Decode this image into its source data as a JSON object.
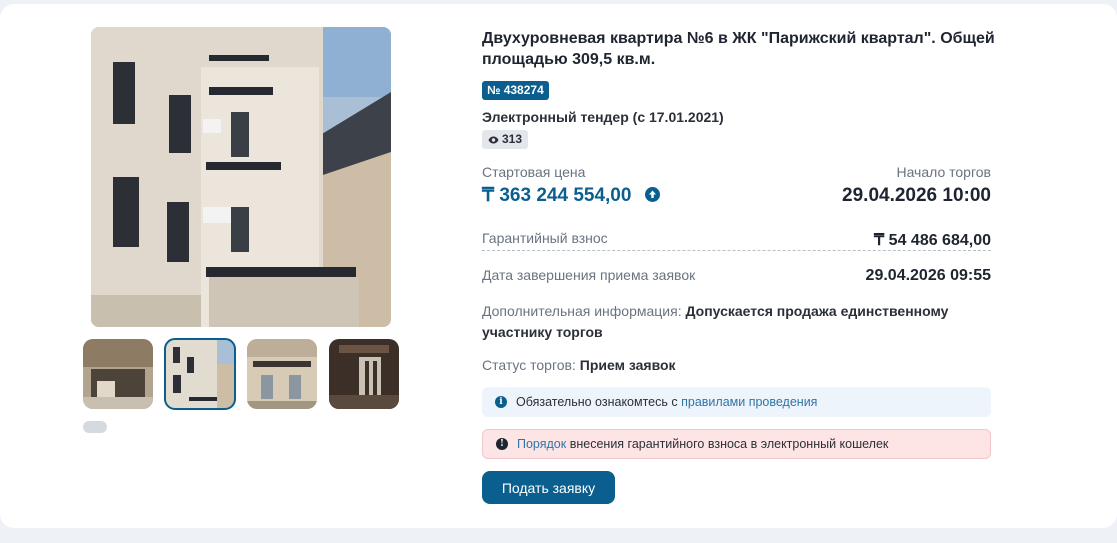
{
  "lot": {
    "title": "Двухуровневая квартира №6 в ЖК \"Парижский квартал\". Общей площадью 309,5 кв.м.",
    "number_badge": "№ 438274",
    "tender_type": "Электронный тендер (с 17.01.2021)",
    "views": "313"
  },
  "pricing": {
    "start_price_label": "Стартовая цена",
    "start_price_value": "₸ 363 244 554,00",
    "auction_start_label": "Начало торгов",
    "auction_start_value": "29.04.2026 10:00",
    "deposit_label": "Гарантийный взнос",
    "deposit_value": "₸ 54 486 684,00",
    "deadline_label": "Дата завершения приема заявок",
    "deadline_value": "29.04.2026 09:55"
  },
  "details": {
    "extra_label": "Дополнительная информация:",
    "extra_value": "Допускается продажа единственному участнику торгов",
    "status_label": "Статус торгов:",
    "status_value": "Прием заявок"
  },
  "alerts": {
    "info_prefix": "Обязательно ознакомтесь с",
    "info_link": "правилами проведения",
    "warn_link": "Порядок",
    "warn_suffix": "внесения гарантийного взноса в электронный кошелек"
  },
  "actions": {
    "submit_label": "Подать заявку"
  },
  "gallery": {
    "selected_thumbnail": 2,
    "thumbnail_count": 4
  },
  "colors": {
    "accent": "#0b5f8f",
    "info_bg": "#eef4fb",
    "warn_bg": "#fde5e6"
  }
}
